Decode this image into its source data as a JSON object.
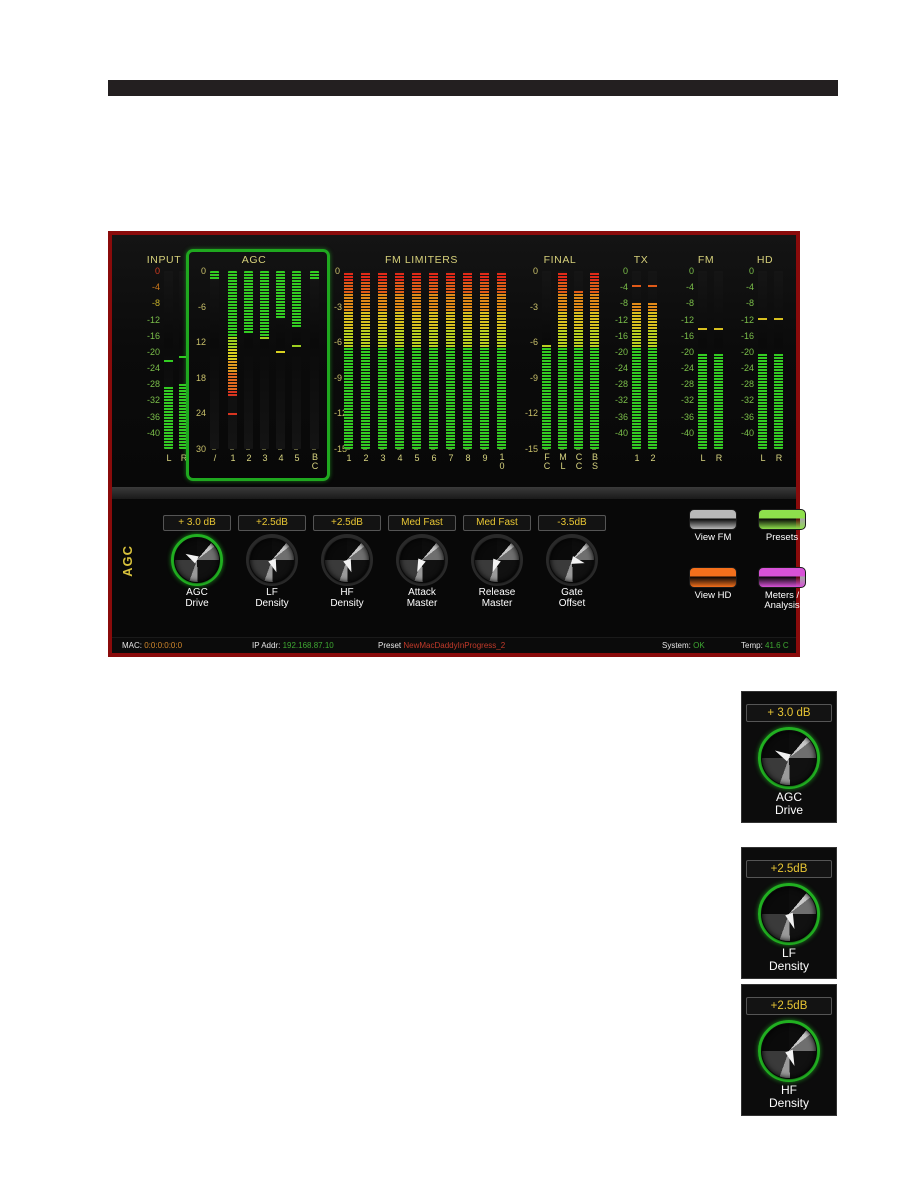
{
  "page": {
    "header_bar": ""
  },
  "device": {
    "meters": {
      "groups": [
        {
          "title": "INPUT",
          "scale": [
            "0",
            "-4",
            "-8",
            "-12",
            "-16",
            "-20",
            "-24",
            "-28",
            "-32",
            "-36",
            "-40"
          ],
          "columns": [
            {
              "label": "L",
              "level_db": -28.5,
              "peak_db": -22.5
            },
            {
              "label": "R",
              "level_db": -28.0,
              "peak_db": -21.5
            }
          ]
        },
        {
          "title": "AGC",
          "scale": [
            "0",
            "-6",
            "12",
            "18",
            "24",
            "30"
          ],
          "columns": [
            {
              "label": "/",
              "level_db": 0,
              "peak_db": null,
              "top_cap": true
            },
            {
              "label": "1",
              "level_db": -21.0,
              "peak_db": -24.0
            },
            {
              "label": "2",
              "level_db": -10.5,
              "peak_db": null
            },
            {
              "label": "3",
              "level_db": -11.5,
              "peak_db": null
            },
            {
              "label": "4",
              "level_db": -8.0,
              "peak_db": -13.5
            },
            {
              "label": "5",
              "level_db": -9.5,
              "peak_db": -12.5
            },
            {
              "label": "BC",
              "level_db": 0,
              "peak_db": null,
              "top_cap": true
            }
          ]
        },
        {
          "title": "FM LIMITERS",
          "scale": [
            "0",
            "-3",
            "-6",
            "-9",
            "-12",
            "-15"
          ],
          "columns": [
            {
              "label": "1",
              "level_db": 0
            },
            {
              "label": "2",
              "level_db": 0
            },
            {
              "label": "3",
              "level_db": 0
            },
            {
              "label": "4",
              "level_db": 0
            },
            {
              "label": "5",
              "level_db": 0
            },
            {
              "label": "6",
              "level_db": 0
            },
            {
              "label": "7",
              "level_db": 0
            },
            {
              "label": "8",
              "level_db": 0
            },
            {
              "label": "9",
              "level_db": 0
            },
            {
              "label": "10",
              "level_db": 0
            }
          ]
        },
        {
          "title": "FINAL",
          "scale": [
            "0",
            "-3",
            "-6",
            "-9",
            "-12",
            "-15"
          ],
          "columns": [
            {
              "label": "FC",
              "level_db": -6.2
            },
            {
              "label": "ML",
              "level_db": 0
            },
            {
              "label": "CC",
              "level_db": -1.6
            },
            {
              "label": "BS",
              "level_db": 0
            }
          ]
        },
        {
          "title": "TX",
          "scale": [
            "0",
            "-4",
            "-8",
            "-12",
            "-16",
            "-20",
            "-24",
            "-28",
            "-32",
            "-36",
            "-40"
          ],
          "columns": [
            {
              "label": "1",
              "level_db": -8.0,
              "peak_db": -4.0
            },
            {
              "label": "2",
              "level_db": -8.0,
              "peak_db": -4.0
            }
          ]
        },
        {
          "title": "FM",
          "scale": [
            "0",
            "-4",
            "-8",
            "-12",
            "-16",
            "-20",
            "-24",
            "-28",
            "-32",
            "-36",
            "-40"
          ],
          "columns": [
            {
              "label": "L",
              "level_db": -20.0,
              "peak_db": -14.5
            },
            {
              "label": "R",
              "level_db": -20.0,
              "peak_db": -14.5
            }
          ]
        },
        {
          "title": "HD",
          "scale": [
            "0",
            "-4",
            "-8",
            "-12",
            "-16",
            "-20",
            "-24",
            "-28",
            "-32",
            "-36",
            "-40"
          ],
          "columns": [
            {
              "label": "L",
              "level_db": -20.0,
              "peak_db": -12.0
            },
            {
              "label": "R",
              "level_db": -20.0,
              "peak_db": -12.0
            }
          ]
        }
      ]
    },
    "controls": {
      "section_label": "AGC",
      "knobs": [
        {
          "value": "+ 3.0 dB",
          "label_line1": "AGC",
          "label_line2": "Drive",
          "selected": true,
          "angle": 118
        },
        {
          "value": "+2.5dB",
          "label_line1": "LF",
          "label_line2": "Density",
          "selected": false,
          "angle": -20
        },
        {
          "value": "+2.5dB",
          "label_line1": "HF",
          "label_line2": "Density",
          "selected": false,
          "angle": -20
        },
        {
          "value": "Med Fast",
          "label_line1": "Attack",
          "label_line2": "Master",
          "selected": false,
          "angle": 22
        },
        {
          "value": "Med Fast",
          "label_line1": "Release",
          "label_line2": "Master",
          "selected": false,
          "angle": 20
        },
        {
          "value": "-3.5dB",
          "label_line1": "Gate",
          "label_line2": "Offset",
          "selected": false,
          "angle": -76
        }
      ],
      "buttons": [
        {
          "label_line1": "View FM",
          "label_line2": "",
          "color": "#b8b8b8"
        },
        {
          "label_line1": "Presets",
          "label_line2": "",
          "color": "#8ee04c"
        },
        {
          "label_line1": "View HD",
          "label_line2": "",
          "color": "#f4701c"
        },
        {
          "label_line1": "Meters /",
          "label_line2": "Analysis",
          "color": "#d852d8"
        }
      ]
    },
    "status": {
      "mac_key": "MAC:",
      "mac_value": "0:0:0:0:0:0",
      "ip_key": "IP Addr:",
      "ip_value": "192.168.87.10",
      "preset_key": "Preset",
      "preset_value": "NewMacDaddyInProgress_2",
      "system_key": "System:",
      "system_value": "OK",
      "temp_key": "Temp:",
      "temp_value": "41.6 C"
    }
  },
  "detail_panels": [
    {
      "value": "+ 3.0 dB",
      "label_line1": "AGC",
      "label_line2": "Drive",
      "angle": 118
    },
    {
      "value": "+2.5dB",
      "label_line1": "LF",
      "label_line2": "Density",
      "angle": -20
    },
    {
      "value": "+2.5dB",
      "label_line1": "HF",
      "label_line2": "Density",
      "angle": -20
    }
  ],
  "colors": {
    "frame_red": "#8a0b0b",
    "agc_highlight_green": "#1fa81f",
    "meter_green": "#33cc22",
    "meter_yellow": "#d8d020",
    "meter_orange": "#e07820",
    "meter_red": "#d82020",
    "scale_text": "#7bbf4a",
    "title_text": "#d6d07a",
    "value_text": "#e8c634"
  }
}
